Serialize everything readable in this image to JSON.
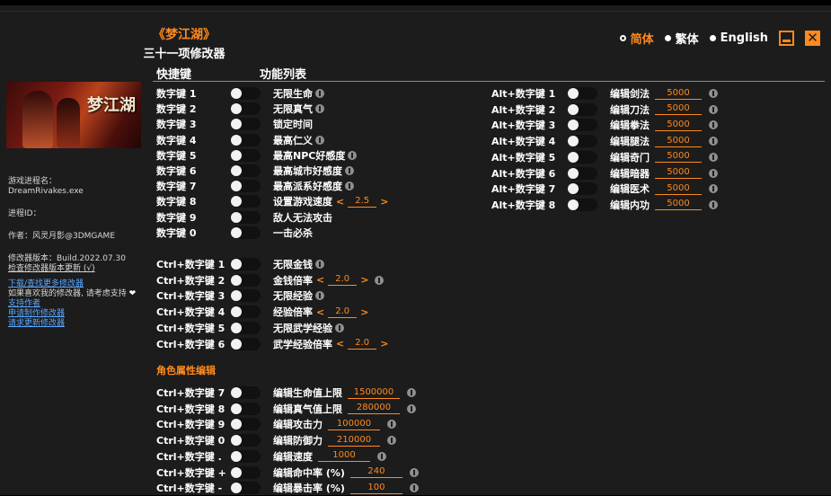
{
  "app": {
    "game_title": "《梦江湖》",
    "subtitle": "三十一项修改器"
  },
  "languages": [
    {
      "label": "简体",
      "selected": true
    },
    {
      "label": "繁体",
      "selected": false
    },
    {
      "label": "English",
      "selected": false
    }
  ],
  "columns": {
    "hotkey": "快捷键",
    "features": "功能列表"
  },
  "sidebar": {
    "process_label": "游戏进程名：",
    "process_value": "DreamRivakes.exe",
    "pid_label": "进程ID：",
    "author": "作者：风灵月影@3DMGAME",
    "version": "修改器版本：Build.2022.07.30",
    "check_update": "检查修改器版本更新 (√)",
    "download_link": "下载/查找更多修改器",
    "support_text": "如果喜欢我的修改器, 请考虑支持",
    "support_link": "支持作者",
    "request_make": "申请制作修改器",
    "request_update": "请求更新修改器"
  },
  "group1": [
    {
      "hotkey": "数字键 1",
      "label": "无限生命",
      "info": true
    },
    {
      "hotkey": "数字键 2",
      "label": "无限真气",
      "info": true
    },
    {
      "hotkey": "数字键 3",
      "label": "锁定时间",
      "info": false
    },
    {
      "hotkey": "数字键 4",
      "label": "最高仁义",
      "info": true
    },
    {
      "hotkey": "数字键 5",
      "label": "最高NPC好感度",
      "info": true
    },
    {
      "hotkey": "数字键 6",
      "label": "最高城市好感度",
      "info": true
    },
    {
      "hotkey": "数字键 7",
      "label": "最高派系好感度",
      "info": true
    },
    {
      "hotkey": "数字键 8",
      "label": "设置游戏速度",
      "info": false,
      "stepper": "2.5"
    },
    {
      "hotkey": "数字键 9",
      "label": "敌人无法攻击",
      "info": false
    },
    {
      "hotkey": "数字键 0",
      "label": "一击必杀",
      "info": false
    }
  ],
  "group2": [
    {
      "hotkey": "Ctrl+数字键 1",
      "label": "无限金钱",
      "info": true
    },
    {
      "hotkey": "Ctrl+数字键 2",
      "label": "金钱倍率",
      "info": true,
      "stepper": "2.0"
    },
    {
      "hotkey": "Ctrl+数字键 3",
      "label": "无限经验",
      "info": true
    },
    {
      "hotkey": "Ctrl+数字键 4",
      "label": "经验倍率",
      "info": false,
      "stepper": "2.0"
    },
    {
      "hotkey": "Ctrl+数字键 5",
      "label": "无限武学经验",
      "info": true
    },
    {
      "hotkey": "Ctrl+数字键 6",
      "label": "武学经验倍率",
      "info": false,
      "stepper": "2.0"
    }
  ],
  "section_title": "角色属性编辑",
  "group3": [
    {
      "hotkey": "Ctrl+数字键 7",
      "label": "编辑生命值上限",
      "value": "1500000"
    },
    {
      "hotkey": "Ctrl+数字键 8",
      "label": "编辑真气值上限",
      "value": "280000"
    },
    {
      "hotkey": "Ctrl+数字键 9",
      "label": "编辑攻击力",
      "value": "100000"
    },
    {
      "hotkey": "Ctrl+数字键 0",
      "label": "编辑防御力",
      "value": "210000"
    },
    {
      "hotkey": "Ctrl+数字键 .",
      "label": "编辑速度",
      "value": "1000"
    },
    {
      "hotkey": "Ctrl+数字键 +",
      "label": "编辑命中率 (%)",
      "value": "240"
    },
    {
      "hotkey": "Ctrl+数字键 -",
      "label": "编辑暴击率 (%)",
      "value": "100"
    }
  ],
  "group4": [
    {
      "hotkey": "Alt+数字键 1",
      "label": "编辑剑法",
      "value": "5000"
    },
    {
      "hotkey": "Alt+数字键 2",
      "label": "编辑刀法",
      "value": "5000"
    },
    {
      "hotkey": "Alt+数字键 3",
      "label": "编辑拳法",
      "value": "5000"
    },
    {
      "hotkey": "Alt+数字键 4",
      "label": "编辑腿法",
      "value": "5000"
    },
    {
      "hotkey": "Alt+数字键 5",
      "label": "编辑奇门",
      "value": "5000"
    },
    {
      "hotkey": "Alt+数字键 6",
      "label": "编辑暗器",
      "value": "5000"
    },
    {
      "hotkey": "Alt+数字键 7",
      "label": "编辑医术",
      "value": "5000"
    },
    {
      "hotkey": "Alt+数字键 8",
      "label": "编辑内功",
      "value": "5000"
    }
  ],
  "colors": {
    "accent": "#ff8a1e",
    "background": "#1c1c1c",
    "link": "#5aa8ff"
  }
}
